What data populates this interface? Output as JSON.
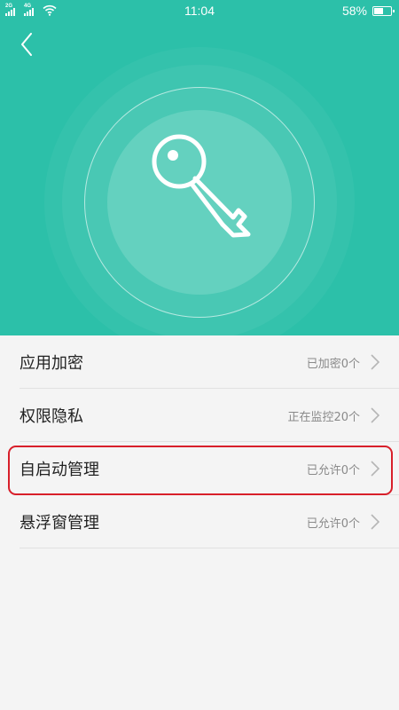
{
  "status_bar": {
    "sim1_label": "2G",
    "sim2_label": "4G",
    "time": "11:04",
    "battery_text": "58%",
    "battery_level": 0.58,
    "icons": [
      "signal-icon",
      "signal-icon",
      "wifi-icon",
      "battery-icon"
    ]
  },
  "header": {
    "back_icon": "chevron-left-icon",
    "hero_icon": "key-icon",
    "accent_color": "#2cc0a9"
  },
  "menu": {
    "items": [
      {
        "label": "应用加密",
        "value": "已加密0个"
      },
      {
        "label": "权限隐私",
        "value": "正在监控20个"
      },
      {
        "label": "自启动管理",
        "value": "已允许0个",
        "highlighted": true
      },
      {
        "label": "悬浮窗管理",
        "value": "已允许0个"
      }
    ],
    "highlight_color": "#d81f2a"
  }
}
